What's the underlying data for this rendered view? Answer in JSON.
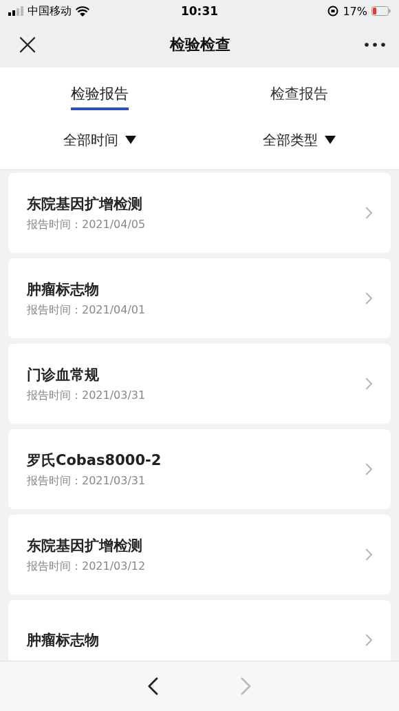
{
  "status_bar": {
    "carrier": "中国移动",
    "time": "10:31",
    "battery": "17%"
  },
  "nav": {
    "title": "检验检查"
  },
  "tabs": [
    {
      "label": "检验报告",
      "selected": true
    },
    {
      "label": "检查报告",
      "selected": false
    }
  ],
  "filters": [
    {
      "label": "全部时间"
    },
    {
      "label": "全部类型"
    }
  ],
  "reports": [
    {
      "title": "东院基因扩增检测",
      "date": "报告时间：2021/04/05"
    },
    {
      "title": "肿瘤标志物",
      "date": "报告时间：2021/04/01"
    },
    {
      "title": "门诊血常规",
      "date": "报告时间：2021/03/31"
    },
    {
      "title": "罗氏Cobas8000-2",
      "date": "报告时间：2021/03/31"
    },
    {
      "title": "东院基因扩增检测",
      "date": "报告时间：2021/03/12"
    },
    {
      "title": "肿瘤标志物"
    }
  ],
  "bottom_bar": {
    "back_disabled": false,
    "forward_disabled": true
  }
}
